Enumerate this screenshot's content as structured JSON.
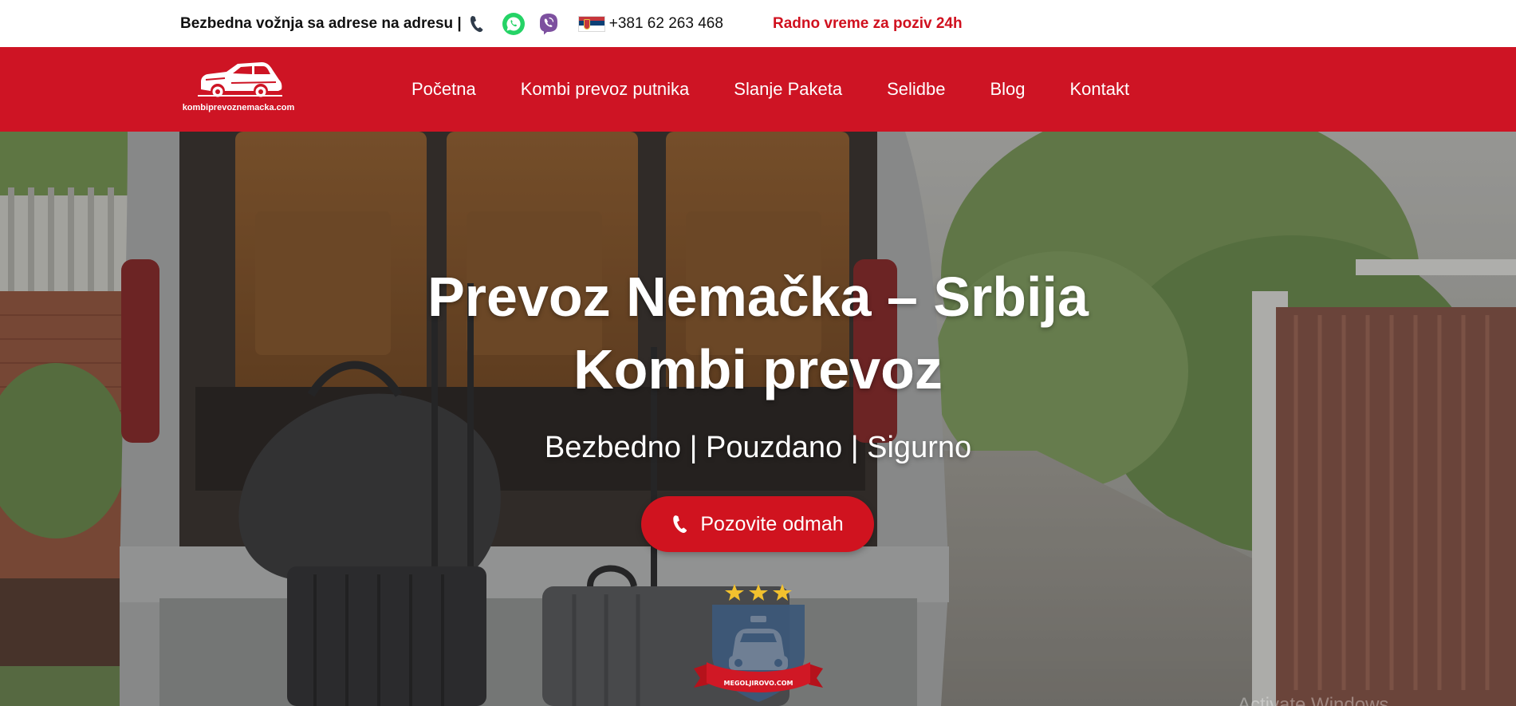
{
  "topbar": {
    "tagline": "Bezbedna vožnja sa adrese na adresu |",
    "phone": "+381 62 263 468",
    "hours": "Radno vreme za poziv 24h",
    "icons": [
      "phone-icon",
      "whatsapp-icon",
      "viber-icon",
      "serbia-flag-icon"
    ]
  },
  "logo": {
    "text": "kombiprevoznemacka.com"
  },
  "nav": {
    "items": [
      {
        "label": "Početna"
      },
      {
        "label": "Kombi prevoz putnika"
      },
      {
        "label": "Slanje Paketa"
      },
      {
        "label": "Selidbe"
      },
      {
        "label": "Blog"
      },
      {
        "label": "Kontakt"
      }
    ]
  },
  "hero": {
    "title_line1": "Prevoz Nemačka – Srbija",
    "title_line2": "Kombi prevoz",
    "subtitle": "Bezbedno | Pouzdano | Sigurno",
    "cta_label": "Pozovite odmah",
    "badge_text": "MEGOLJIROVO.COM",
    "watermark": "Activate Windows"
  },
  "colors": {
    "brand_red": "#ce1424",
    "hours_red": "#d0101e",
    "white": "#ffffff",
    "text_dark": "#111111"
  }
}
